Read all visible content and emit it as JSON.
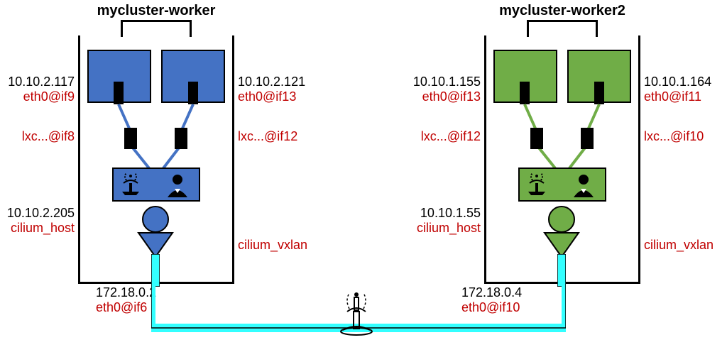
{
  "nodes": [
    {
      "title": "mycluster-worker",
      "pod1_ip": "10.10.2.117",
      "pod1_dev": "eth0@if9",
      "pod2_ip": "10.10.2.121",
      "pod2_dev": "eth0@if13",
      "lxc1": "lxc...@if8",
      "lxc2": "lxc...@if12",
      "host_ip": "10.10.2.205",
      "host_dev": "cilium_host",
      "vxlan_dev": "cilium_vxlan",
      "ext_ip": "172.18.0.2",
      "ext_dev": "eth0@if6"
    },
    {
      "title": "mycluster-worker2",
      "pod1_ip": "10.10.1.155",
      "pod1_dev": "eth0@if13",
      "pod2_ip": "10.10.1.164",
      "pod2_dev": "eth0@if11",
      "lxc1": "lxc...@if12",
      "lxc2": "lxc...@if10",
      "host_ip": "10.10.1.55",
      "host_dev": "cilium_host",
      "vxlan_dev": "cilium_vxlan",
      "ext_ip": "172.18.0.4",
      "ext_dev": "eth0@if10"
    }
  ]
}
